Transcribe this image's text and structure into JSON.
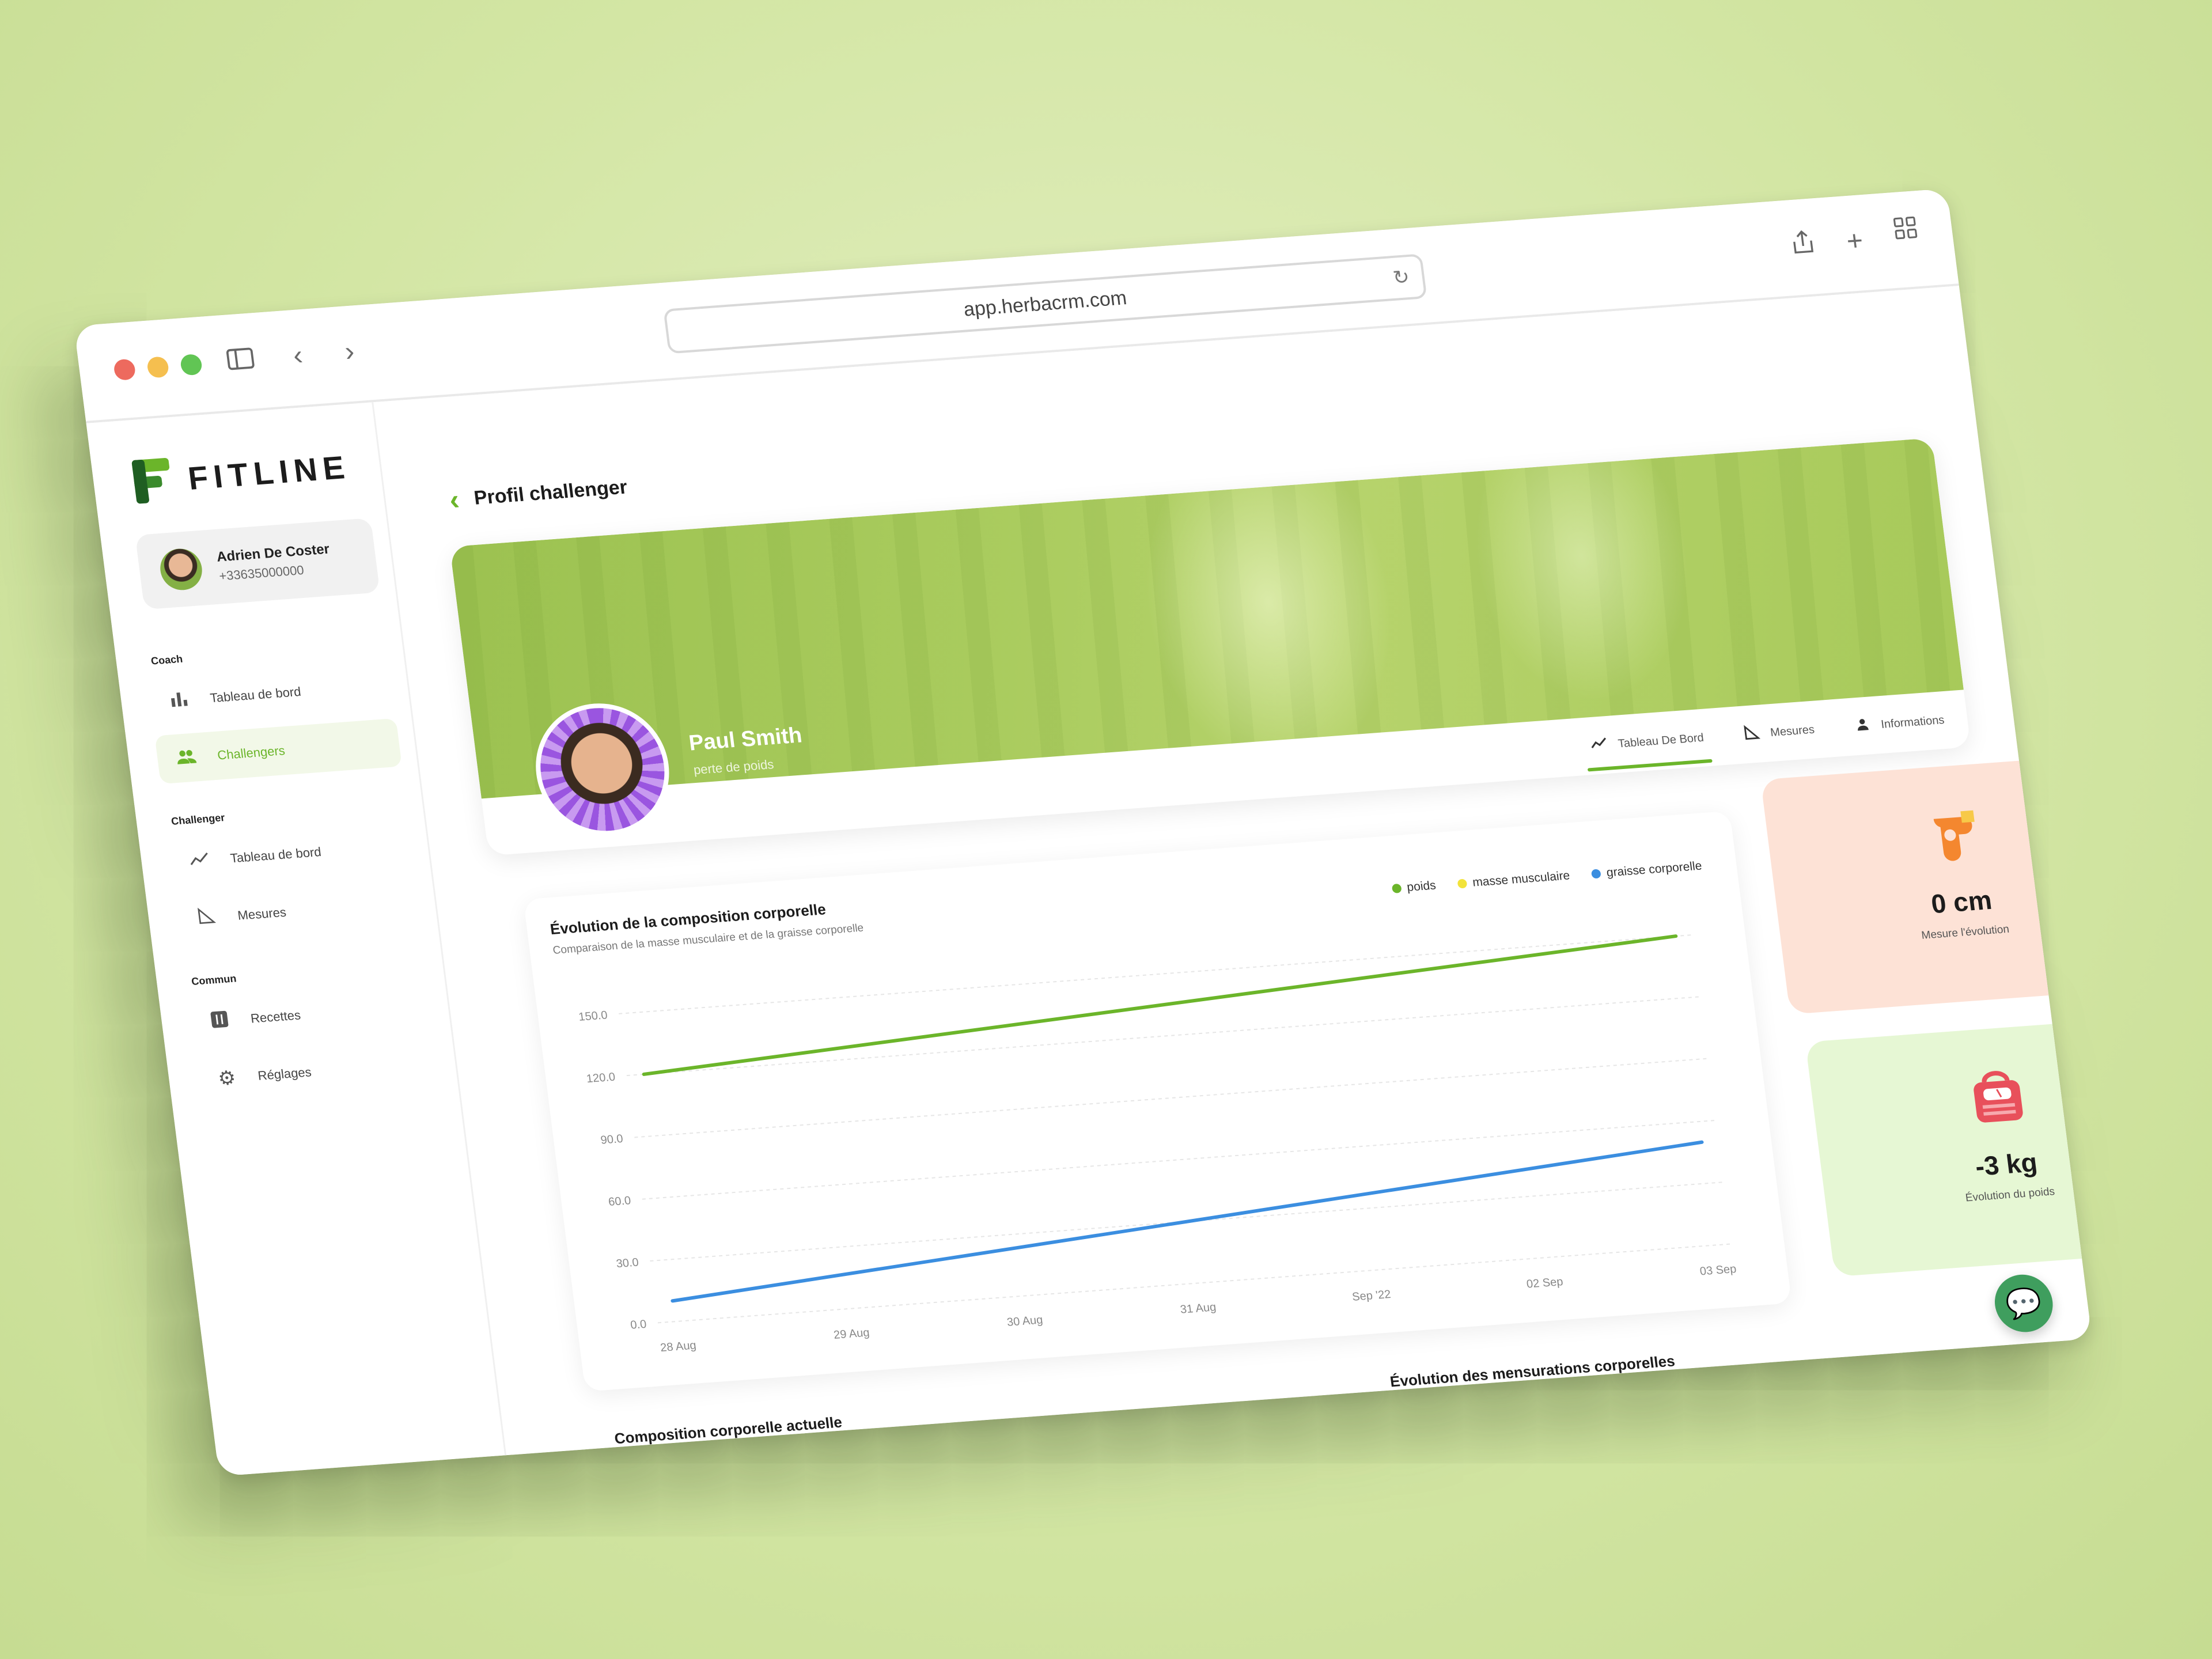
{
  "browser": {
    "url": "app.herbacrm.com"
  },
  "brand": {
    "name": "FITLINE",
    "accent": "#6bb52a"
  },
  "user": {
    "name": "Adrien De Coster",
    "phone": "+33635000000"
  },
  "sidebar": {
    "sections": [
      {
        "label": "Coach"
      },
      {
        "label": "Challenger"
      },
      {
        "label": "Commun"
      }
    ],
    "items": [
      {
        "label": "Tableau de bord",
        "icon": "bar-chart-icon"
      },
      {
        "label": "Challengers",
        "icon": "users-icon",
        "active": true
      },
      {
        "label": "Tableau de bord",
        "icon": "trend-line-icon"
      },
      {
        "label": "Mesures",
        "icon": "ruler-triangle-icon"
      },
      {
        "label": "Recettes",
        "icon": "utensils-icon"
      },
      {
        "label": "Réglages",
        "icon": "gear-icon"
      }
    ]
  },
  "page": {
    "title": "Profil challenger"
  },
  "profile": {
    "name": "Paul Smith",
    "goal": "perte de poids",
    "tabs": [
      {
        "label": "Tableau De Bord",
        "icon": "trend-line-icon",
        "active": true
      },
      {
        "label": "Mesures",
        "icon": "ruler-triangle-icon"
      },
      {
        "label": "Informations",
        "icon": "person-icon"
      }
    ]
  },
  "stats": {
    "measure": {
      "value": "0 cm",
      "label": "Mesure l'évolution",
      "icon": "measuring-tape-icon"
    },
    "weight": {
      "value": "-3 kg",
      "label": "Évolution du poids",
      "icon": "scale-icon"
    }
  },
  "sections": {
    "current_composition": "Composition corporelle actuelle",
    "measurements_evolution": "Évolution des mensurations corporelles"
  },
  "chart_data": {
    "type": "line",
    "title": "Évolution de la composition corporelle",
    "subtitle": "Comparaison de la masse musculaire et de la graisse corporelle",
    "categories": [
      "28 Aug",
      "29 Aug",
      "30 Aug",
      "31 Aug",
      "Sep '22",
      "02 Sep",
      "03 Sep"
    ],
    "y_ticks": [
      "150.0",
      "120.0",
      "90.0",
      "60.0",
      "30.0",
      "0.0"
    ],
    "ylim": [
      0,
      150
    ],
    "legend_position": "top-right",
    "grid": true,
    "series": [
      {
        "name": "poids",
        "color": "#6bb52a",
        "x": [
          "28 Aug",
          "03 Sep"
        ],
        "values": [
          120,
          150
        ]
      },
      {
        "name": "masse musculaire",
        "color": "#f2e33a",
        "x": [],
        "values": []
      },
      {
        "name": "graisse corporelle",
        "color": "#3b8ee0",
        "x": [
          "28 Aug",
          "03 Sep"
        ],
        "values": [
          10,
          50
        ]
      }
    ]
  }
}
